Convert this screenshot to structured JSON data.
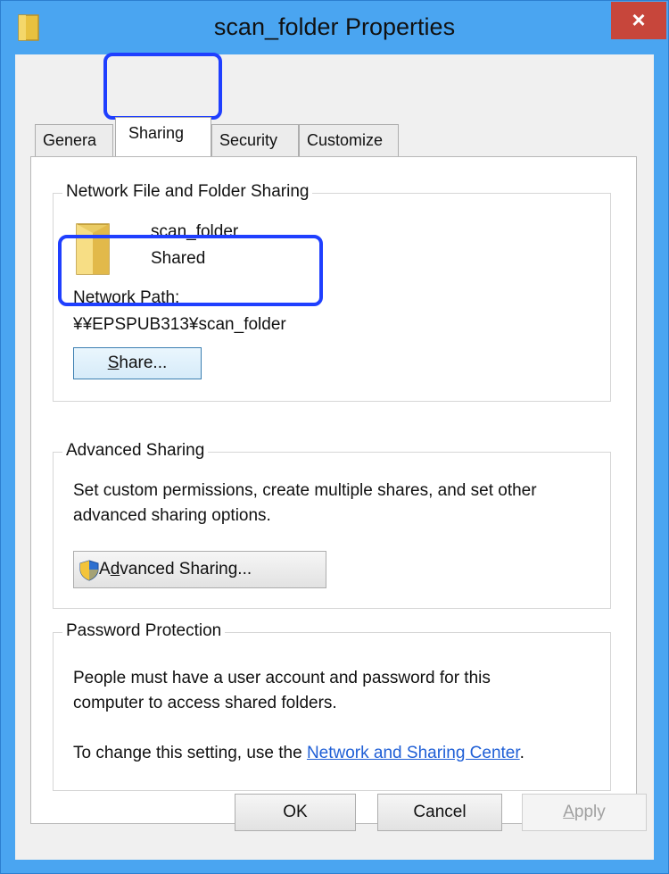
{
  "window": {
    "title": "scan_folder Properties",
    "close_label": "×"
  },
  "tabs": [
    {
      "label": "General",
      "shown": "Genera"
    },
    {
      "label": "Sharing"
    },
    {
      "label": "Security",
      "shown": "Security"
    },
    {
      "label": "Customize"
    }
  ],
  "network_sharing": {
    "group_title": "Network File and Folder Sharing",
    "folder_name": "scan_folder",
    "folder_status": "Shared",
    "path_label_first": "N",
    "path_label_rest": "etwork Path:",
    "path_value": "¥¥EPSPUB313¥scan_folder",
    "share_button": {
      "first": "S",
      "rest": "hare..."
    }
  },
  "advanced_sharing": {
    "group_title": "Advanced Sharing",
    "description_line1": "Set custom permissions, create multiple shares, and set other",
    "description_line2": "advanced sharing options.",
    "button": {
      "pre": "A",
      "first": "d",
      "rest": "vanced Sharing..."
    }
  },
  "password_protection": {
    "group_title": "Password Protection",
    "text_line1": "People must have a user account and password for this",
    "text_line2": "computer to access shared folders.",
    "change_prefix": "To change this setting, use the ",
    "link": "Network and Sharing Center",
    "change_suffix": "."
  },
  "footer": {
    "ok": "OK",
    "cancel": "Cancel",
    "apply_first": "A",
    "apply_rest": "pply"
  },
  "colors": {
    "frame": "#4aa5f1",
    "close": "#c7463b",
    "highlight": "#1f3fff",
    "link": "#1f5fd6"
  }
}
